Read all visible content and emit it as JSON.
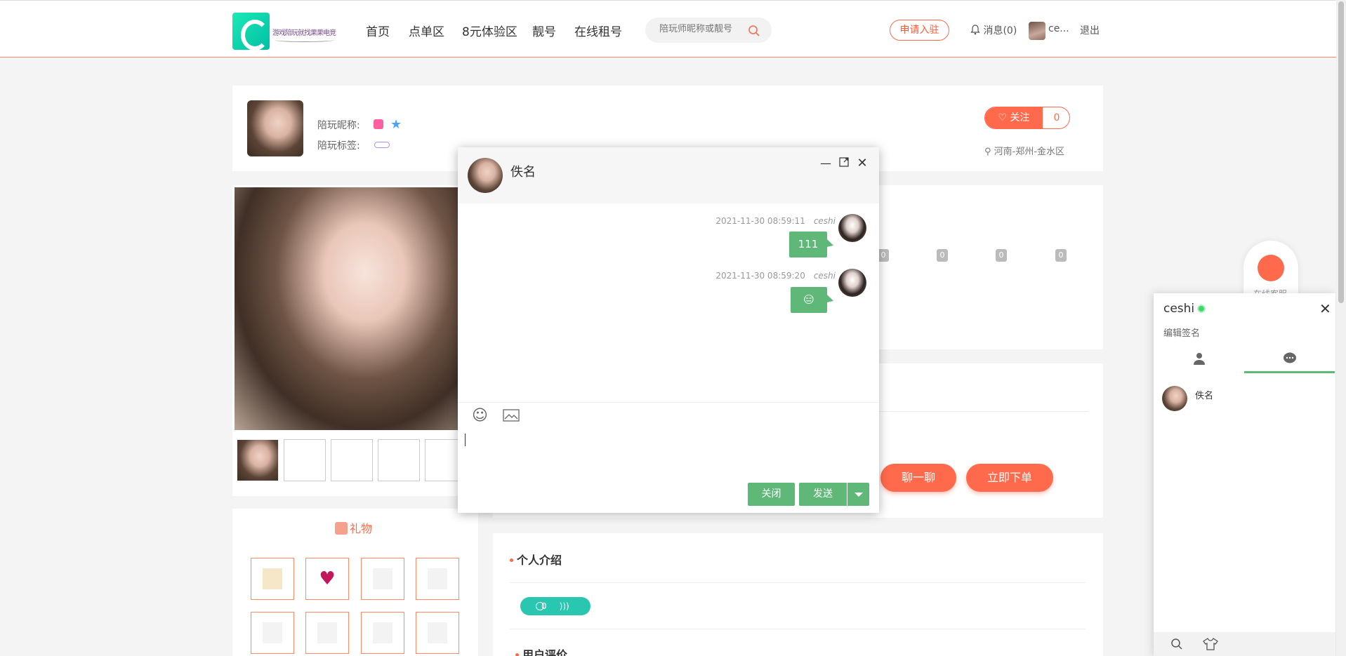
{
  "header": {
    "logo_text": "游戏陪玩就找果果电竞",
    "nav": [
      "首页",
      "点单区",
      "8元体验区",
      "靓号",
      "在线租号"
    ],
    "search_placeholder": "陪玩师昵称或靓号",
    "apply_label": "申请入驻",
    "messages_label": "消息(0)",
    "user_name": "ce...",
    "logout_label": "退出"
  },
  "profile": {
    "nickname_label": "陪玩昵称:",
    "tags_label": "陪玩标签:",
    "follow_label": "关注",
    "follow_count": "0",
    "location": "河南-郑州-金水区"
  },
  "stats": [
    "0",
    "0",
    "0",
    "0"
  ],
  "actions": {
    "chat_label": "聊一聊",
    "order_label": "立即下单"
  },
  "gifts": {
    "title": "礼物"
  },
  "intro": {
    "title": "个人介绍",
    "voice_count": "0",
    "reviews_title": "用户评价"
  },
  "service": {
    "label": "在线客服"
  },
  "chat_window": {
    "contact_name": "佚名",
    "messages": [
      {
        "time": "2021-11-30 08:59:11",
        "user": "ceshi",
        "text": "111"
      },
      {
        "time": "2021-11-30 08:59:20",
        "user": "ceshi",
        "text": "😑"
      }
    ],
    "close_label": "关闭",
    "send_label": "发送"
  },
  "side_panel": {
    "user_name": "ceshi",
    "signature": "编辑签名",
    "contacts": [
      {
        "name": "佚名"
      }
    ]
  },
  "colors": {
    "accent": "#ff6a4d",
    "chat_green": "#5fb878",
    "voice_teal": "#29c7b0"
  }
}
